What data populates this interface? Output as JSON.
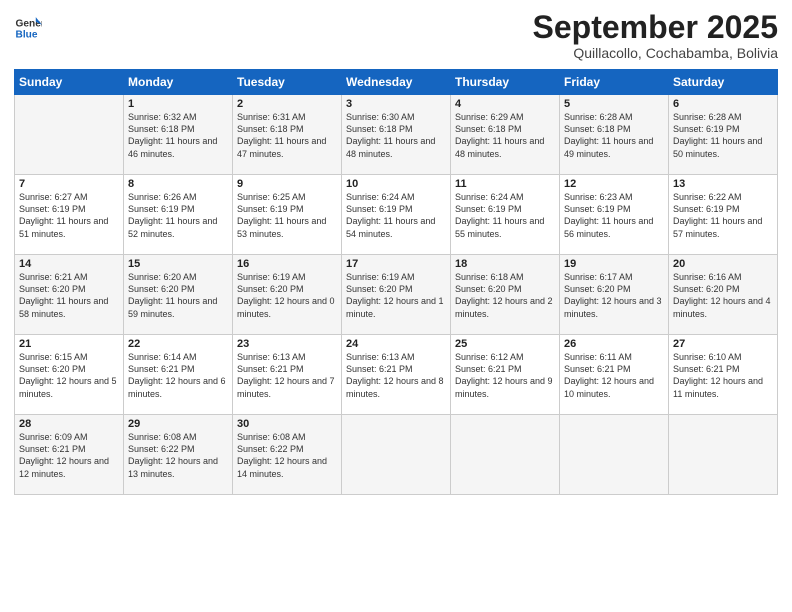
{
  "logo": {
    "line1": "General",
    "line2": "Blue"
  },
  "title": "September 2025",
  "subtitle": "Quillacollo, Cochabamba, Bolivia",
  "weekdays": [
    "Sunday",
    "Monday",
    "Tuesday",
    "Wednesday",
    "Thursday",
    "Friday",
    "Saturday"
  ],
  "weeks": [
    [
      {
        "day": "",
        "sunrise": "",
        "sunset": "",
        "daylight": ""
      },
      {
        "day": "1",
        "sunrise": "Sunrise: 6:32 AM",
        "sunset": "Sunset: 6:18 PM",
        "daylight": "Daylight: 11 hours and 46 minutes."
      },
      {
        "day": "2",
        "sunrise": "Sunrise: 6:31 AM",
        "sunset": "Sunset: 6:18 PM",
        "daylight": "Daylight: 11 hours and 47 minutes."
      },
      {
        "day": "3",
        "sunrise": "Sunrise: 6:30 AM",
        "sunset": "Sunset: 6:18 PM",
        "daylight": "Daylight: 11 hours and 48 minutes."
      },
      {
        "day": "4",
        "sunrise": "Sunrise: 6:29 AM",
        "sunset": "Sunset: 6:18 PM",
        "daylight": "Daylight: 11 hours and 48 minutes."
      },
      {
        "day": "5",
        "sunrise": "Sunrise: 6:28 AM",
        "sunset": "Sunset: 6:18 PM",
        "daylight": "Daylight: 11 hours and 49 minutes."
      },
      {
        "day": "6",
        "sunrise": "Sunrise: 6:28 AM",
        "sunset": "Sunset: 6:19 PM",
        "daylight": "Daylight: 11 hours and 50 minutes."
      }
    ],
    [
      {
        "day": "7",
        "sunrise": "Sunrise: 6:27 AM",
        "sunset": "Sunset: 6:19 PM",
        "daylight": "Daylight: 11 hours and 51 minutes."
      },
      {
        "day": "8",
        "sunrise": "Sunrise: 6:26 AM",
        "sunset": "Sunset: 6:19 PM",
        "daylight": "Daylight: 11 hours and 52 minutes."
      },
      {
        "day": "9",
        "sunrise": "Sunrise: 6:25 AM",
        "sunset": "Sunset: 6:19 PM",
        "daylight": "Daylight: 11 hours and 53 minutes."
      },
      {
        "day": "10",
        "sunrise": "Sunrise: 6:24 AM",
        "sunset": "Sunset: 6:19 PM",
        "daylight": "Daylight: 11 hours and 54 minutes."
      },
      {
        "day": "11",
        "sunrise": "Sunrise: 6:24 AM",
        "sunset": "Sunset: 6:19 PM",
        "daylight": "Daylight: 11 hours and 55 minutes."
      },
      {
        "day": "12",
        "sunrise": "Sunrise: 6:23 AM",
        "sunset": "Sunset: 6:19 PM",
        "daylight": "Daylight: 11 hours and 56 minutes."
      },
      {
        "day": "13",
        "sunrise": "Sunrise: 6:22 AM",
        "sunset": "Sunset: 6:19 PM",
        "daylight": "Daylight: 11 hours and 57 minutes."
      }
    ],
    [
      {
        "day": "14",
        "sunrise": "Sunrise: 6:21 AM",
        "sunset": "Sunset: 6:20 PM",
        "daylight": "Daylight: 11 hours and 58 minutes."
      },
      {
        "day": "15",
        "sunrise": "Sunrise: 6:20 AM",
        "sunset": "Sunset: 6:20 PM",
        "daylight": "Daylight: 11 hours and 59 minutes."
      },
      {
        "day": "16",
        "sunrise": "Sunrise: 6:19 AM",
        "sunset": "Sunset: 6:20 PM",
        "daylight": "Daylight: 12 hours and 0 minutes."
      },
      {
        "day": "17",
        "sunrise": "Sunrise: 6:19 AM",
        "sunset": "Sunset: 6:20 PM",
        "daylight": "Daylight: 12 hours and 1 minute."
      },
      {
        "day": "18",
        "sunrise": "Sunrise: 6:18 AM",
        "sunset": "Sunset: 6:20 PM",
        "daylight": "Daylight: 12 hours and 2 minutes."
      },
      {
        "day": "19",
        "sunrise": "Sunrise: 6:17 AM",
        "sunset": "Sunset: 6:20 PM",
        "daylight": "Daylight: 12 hours and 3 minutes."
      },
      {
        "day": "20",
        "sunrise": "Sunrise: 6:16 AM",
        "sunset": "Sunset: 6:20 PM",
        "daylight": "Daylight: 12 hours and 4 minutes."
      }
    ],
    [
      {
        "day": "21",
        "sunrise": "Sunrise: 6:15 AM",
        "sunset": "Sunset: 6:20 PM",
        "daylight": "Daylight: 12 hours and 5 minutes."
      },
      {
        "day": "22",
        "sunrise": "Sunrise: 6:14 AM",
        "sunset": "Sunset: 6:21 PM",
        "daylight": "Daylight: 12 hours and 6 minutes."
      },
      {
        "day": "23",
        "sunrise": "Sunrise: 6:13 AM",
        "sunset": "Sunset: 6:21 PM",
        "daylight": "Daylight: 12 hours and 7 minutes."
      },
      {
        "day": "24",
        "sunrise": "Sunrise: 6:13 AM",
        "sunset": "Sunset: 6:21 PM",
        "daylight": "Daylight: 12 hours and 8 minutes."
      },
      {
        "day": "25",
        "sunrise": "Sunrise: 6:12 AM",
        "sunset": "Sunset: 6:21 PM",
        "daylight": "Daylight: 12 hours and 9 minutes."
      },
      {
        "day": "26",
        "sunrise": "Sunrise: 6:11 AM",
        "sunset": "Sunset: 6:21 PM",
        "daylight": "Daylight: 12 hours and 10 minutes."
      },
      {
        "day": "27",
        "sunrise": "Sunrise: 6:10 AM",
        "sunset": "Sunset: 6:21 PM",
        "daylight": "Daylight: 12 hours and 11 minutes."
      }
    ],
    [
      {
        "day": "28",
        "sunrise": "Sunrise: 6:09 AM",
        "sunset": "Sunset: 6:21 PM",
        "daylight": "Daylight: 12 hours and 12 minutes."
      },
      {
        "day": "29",
        "sunrise": "Sunrise: 6:08 AM",
        "sunset": "Sunset: 6:22 PM",
        "daylight": "Daylight: 12 hours and 13 minutes."
      },
      {
        "day": "30",
        "sunrise": "Sunrise: 6:08 AM",
        "sunset": "Sunset: 6:22 PM",
        "daylight": "Daylight: 12 hours and 14 minutes."
      },
      {
        "day": "",
        "sunrise": "",
        "sunset": "",
        "daylight": ""
      },
      {
        "day": "",
        "sunrise": "",
        "sunset": "",
        "daylight": ""
      },
      {
        "day": "",
        "sunrise": "",
        "sunset": "",
        "daylight": ""
      },
      {
        "day": "",
        "sunrise": "",
        "sunset": "",
        "daylight": ""
      }
    ]
  ]
}
